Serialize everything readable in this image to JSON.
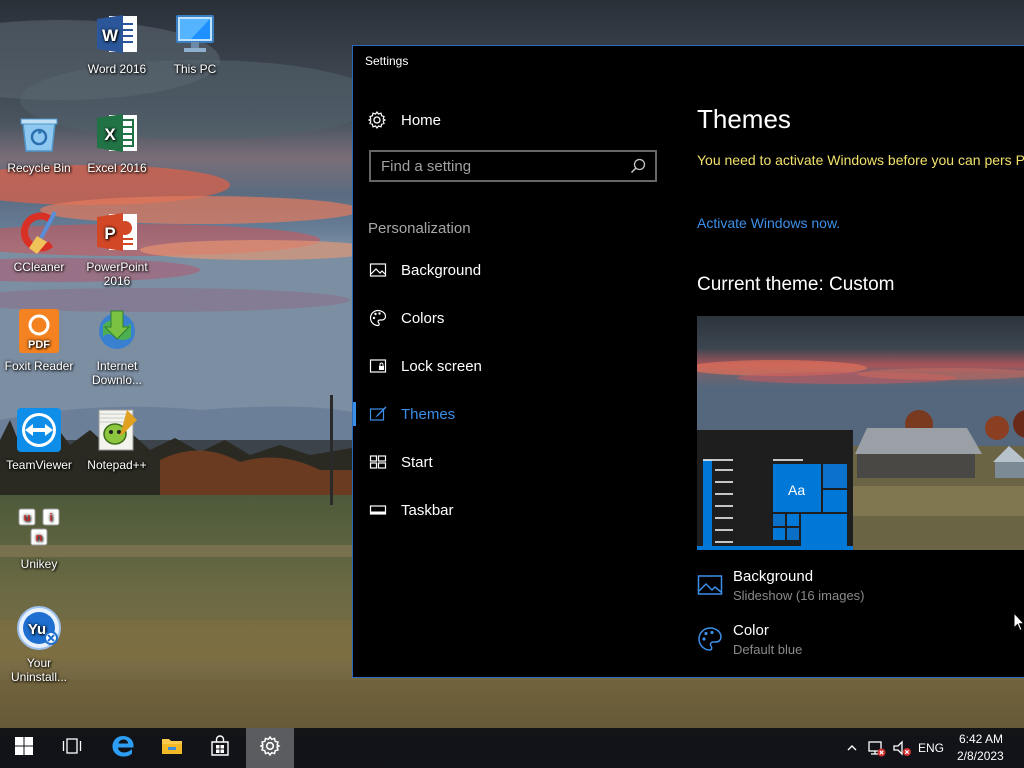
{
  "desktop": {
    "icons": [
      {
        "label": "Word 2016",
        "icon": "word-icon"
      },
      {
        "label": "This PC",
        "icon": "this-pc-icon"
      },
      {
        "label": "Recycle Bin",
        "icon": "recycle-bin-icon"
      },
      {
        "label": "Excel 2016",
        "icon": "excel-icon"
      },
      {
        "label": "CCleaner",
        "icon": "ccleaner-icon"
      },
      {
        "label": "PowerPoint 2016",
        "icon": "powerpoint-icon"
      },
      {
        "label": "Foxit Reader",
        "icon": "foxit-reader-icon"
      },
      {
        "label": "Internet Downlo...",
        "icon": "internet-download-manager-icon"
      },
      {
        "label": "TeamViewer",
        "icon": "teamviewer-icon"
      },
      {
        "label": "Notepad++",
        "icon": "notepad-plus-plus-icon"
      },
      {
        "label": "Unikey",
        "icon": "unikey-icon"
      },
      {
        "label": "Your Uninstall...",
        "icon": "your-uninstaller-icon"
      }
    ]
  },
  "settings": {
    "window_title": "Settings",
    "home_label": "Home",
    "search_placeholder": "Find a setting",
    "section_title": "Personalization",
    "nav_items": [
      {
        "label": "Background",
        "icon": "picture-icon",
        "active": false
      },
      {
        "label": "Colors",
        "icon": "palette-icon",
        "active": false
      },
      {
        "label": "Lock screen",
        "icon": "lock-screen-icon",
        "active": false
      },
      {
        "label": "Themes",
        "icon": "brush-icon",
        "active": true
      },
      {
        "label": "Start",
        "icon": "start-tiles-icon",
        "active": false
      },
      {
        "label": "Taskbar",
        "icon": "taskbar-icon",
        "active": false
      }
    ],
    "page_title": "Themes",
    "activation_warning": "You need to activate Windows before you can pers PC.",
    "activate_link": "Activate Windows now.",
    "current_theme": "Current theme: Custom",
    "preview_tile_text": "Aa",
    "properties": [
      {
        "title": "Background",
        "subtitle": "Slideshow (16 images)",
        "icon": "picture-icon"
      },
      {
        "title": "Color",
        "subtitle": "Default blue",
        "icon": "palette-icon"
      }
    ]
  },
  "taskbar": {
    "buttons": [
      "start-icon",
      "task-view-icon",
      "edge-icon",
      "file-explorer-icon",
      "store-icon",
      "settings-gear-icon"
    ],
    "active_button": "settings-gear-icon",
    "tray": {
      "language": "ENG",
      "time": "6:42 AM",
      "date": "2/8/2023"
    }
  },
  "colors": {
    "accent": "#3c8fe8",
    "warning": "#f1e16a",
    "window_bg": "#000000",
    "window_border": "#2b6bbd"
  }
}
